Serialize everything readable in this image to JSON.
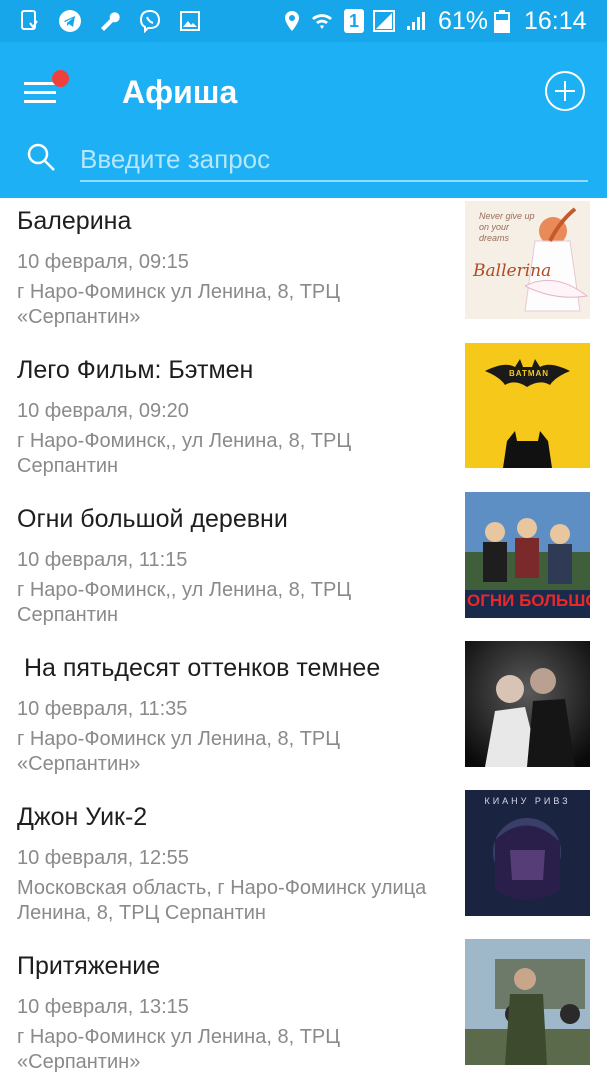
{
  "status_bar": {
    "battery_percent": "61%",
    "time": "16:14",
    "sim_slot": "1",
    "icons": [
      "screen-icon",
      "telegram-icon",
      "wrench-icon",
      "viber-icon",
      "gallery-icon",
      "location-icon",
      "wifi-icon",
      "sim-icon",
      "signal-icon",
      "battery-icon"
    ]
  },
  "app_bar": {
    "title": "Афиша",
    "menu_icon": "hamburger-icon",
    "add_icon": "plus-circle-icon",
    "search_placeholder": "Введите запрос",
    "search_value": ""
  },
  "colors": {
    "status_bar": "#16a6e9",
    "app_bar": "#1eb0f4",
    "badge": "#f0403e",
    "title_text": "#1e1e1e",
    "secondary_text": "#8a8a8a"
  },
  "events": [
    {
      "title": "Балерина",
      "date": "10 февраля, 09:15",
      "address": "г Наро-Фоминск ул Ленина, 8, ТРЦ «Серпантин»",
      "poster": {
        "title": "Ballerina",
        "tagline": "Never give up on your dreams"
      }
    },
    {
      "title": "Лего Фильм: Бэтмен",
      "date": "10 февраля, 09:20",
      "address": "г Наро-Фоминск,, ул Ленина, 8, ТРЦ Серпантин",
      "poster": {
        "title": "BATMAN"
      }
    },
    {
      "title": "Огни большой деревни",
      "date": "10 февраля, 11:15",
      "address": "г Наро-Фоминск,, ул Ленина, 8, ТРЦ Серпантин",
      "poster": {
        "title": "ОГНИ БОЛЬШОЙ"
      }
    },
    {
      "title": " На пятьдесят оттенков темнее",
      "date": "10 февраля, 11:35",
      "address": "г Наро-Фоминск ул Ленина, 8, ТРЦ «Серпантин»",
      "poster": {
        "title": ""
      }
    },
    {
      "title": "Джон Уик-2",
      "date": "10 февраля, 12:55",
      "address": "Московская область, г Наро-Фоминск улица Ленина, 8, ТРЦ Серпантин",
      "poster": {
        "title": "КИАНУ РИВЗ"
      }
    },
    {
      "title": "Притяжение",
      "date": "10 февраля, 13:15",
      "address": "г Наро-Фоминск ул Ленина, 8, ТРЦ «Серпантин»",
      "poster": {
        "title": ""
      }
    }
  ]
}
